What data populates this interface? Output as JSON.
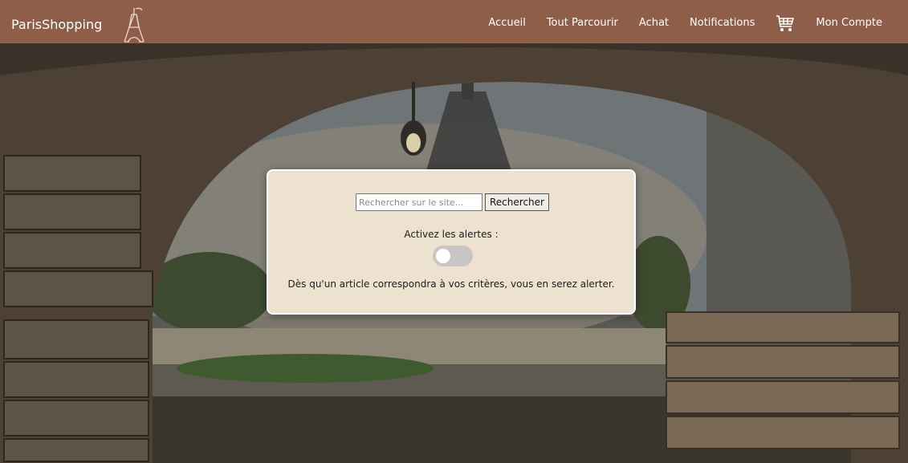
{
  "header": {
    "brand": "ParisShopping",
    "nav": [
      {
        "label": "Accueil"
      },
      {
        "label": "Tout Parcourir"
      },
      {
        "label": "Achat"
      },
      {
        "label": "Notifications"
      }
    ],
    "cart_icon": "cart-icon",
    "account": "Mon Compte",
    "logo_icon": "eiffel-tower-icon"
  },
  "panel": {
    "search_placeholder": "Rechercher sur le site...",
    "search_button": "Rechercher",
    "alert_label": "Activez les alertes :",
    "alert_toggle_on": false,
    "alert_description": "Dès qu'un article correspondra à vos critères, vous en serez alerter."
  },
  "colors": {
    "header_bg": "#8e5e49",
    "panel_bg": "#ede1cf"
  }
}
